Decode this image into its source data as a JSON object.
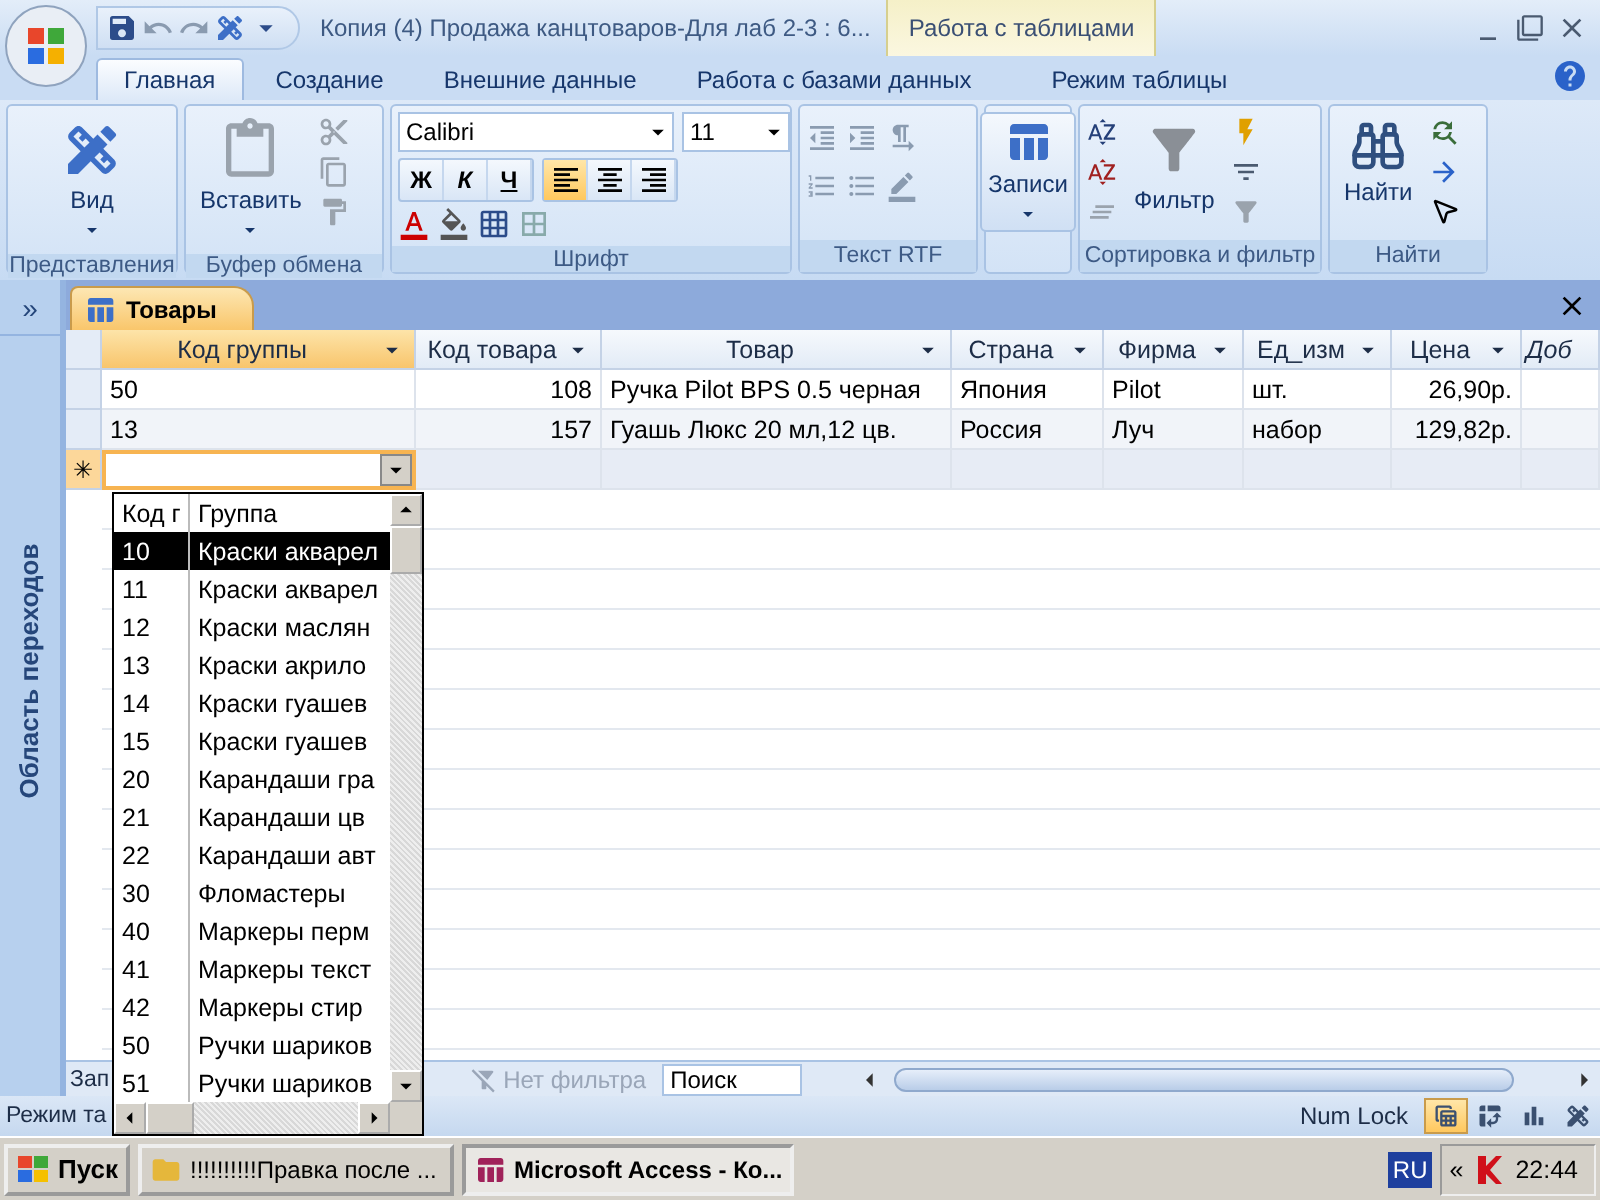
{
  "title_bar": {
    "title": "Копия (4) Продажа канцтоваров-Для лаб 2-3 : 6...",
    "context_tab": "Работа с таблицами"
  },
  "ribbon_tabs": [
    {
      "label": "Главная",
      "selected": true
    },
    {
      "label": "Создание",
      "selected": false
    },
    {
      "label": "Внешние данные",
      "selected": false
    },
    {
      "label": "Работа с базами данных",
      "selected": false
    },
    {
      "label": "Режим таблицы",
      "selected": false
    }
  ],
  "ribbon": {
    "views": {
      "label": "Представления",
      "button": "Вид"
    },
    "clipboard": {
      "label": "Буфер обмена",
      "button": "Вставить"
    },
    "font": {
      "label": "Шрифт",
      "font_name": "Calibri",
      "font_size": "11",
      "styles": [
        "Ж",
        "К",
        "Ч"
      ],
      "alignments": [
        {
          "selected": true
        },
        {
          "selected": false
        },
        {
          "selected": false
        }
      ]
    },
    "rich_text": {
      "label": "Текст RTF"
    },
    "records": {
      "button": "Записи"
    },
    "sort_filter": {
      "label": "Сортировка и фильтр",
      "button": "Фильтр"
    },
    "find": {
      "label": "Найти",
      "button": "Найти"
    }
  },
  "nav_pane": {
    "toggle": "»",
    "title": "Область переходов"
  },
  "document": {
    "tab": "Товары"
  },
  "table": {
    "columns": [
      {
        "label": "Код группы",
        "kind": "lookup",
        "selected": true
      },
      {
        "label": "Код товара",
        "kind": "number",
        "selected": false
      },
      {
        "label": "Товар",
        "kind": "text",
        "selected": false
      },
      {
        "label": "Страна",
        "kind": "text",
        "selected": false
      },
      {
        "label": "Фирма",
        "kind": "text",
        "selected": false
      },
      {
        "label": "Ед_изм",
        "kind": "text",
        "selected": false
      },
      {
        "label": "Цена",
        "kind": "number",
        "selected": false
      },
      {
        "label": "Доб",
        "kind": "new",
        "selected": false
      }
    ],
    "rows": [
      {
        "cells": [
          "50",
          "108",
          "Ручка Pilot BPS 0.5 черная",
          "Япония",
          "Pilot",
          "шт.",
          "26,90р."
        ]
      },
      {
        "cells": [
          "13",
          "157",
          "Гуашь Люкс 20 мл,12 цв.",
          "Россия",
          "Луч",
          "набор",
          "129,82р."
        ]
      }
    ],
    "new_row_marker": "✳"
  },
  "lookup_list": {
    "columns": [
      "Код г",
      "Группа"
    ],
    "items": [
      {
        "code": "10",
        "name": "Краски акварел",
        "selected": true
      },
      {
        "code": "11",
        "name": "Краски акварел",
        "selected": false
      },
      {
        "code": "12",
        "name": "Краски маслян",
        "selected": false
      },
      {
        "code": "13",
        "name": "Краски акрило",
        "selected": false
      },
      {
        "code": "14",
        "name": "Краски гуашев",
        "selected": false
      },
      {
        "code": "15",
        "name": "Краски гуашев",
        "selected": false
      },
      {
        "code": "20",
        "name": "Карандаши гра",
        "selected": false
      },
      {
        "code": "21",
        "name": "Карандаши цв",
        "selected": false
      },
      {
        "code": "22",
        "name": "Карандаши авт",
        "selected": false
      },
      {
        "code": "30",
        "name": "Фломастеры",
        "selected": false
      },
      {
        "code": "40",
        "name": "Маркеры перм",
        "selected": false
      },
      {
        "code": "41",
        "name": "Маркеры текст",
        "selected": false
      },
      {
        "code": "42",
        "name": "Маркеры стир",
        "selected": false
      },
      {
        "code": "50",
        "name": "Ручки шариков",
        "selected": false
      },
      {
        "code": "51",
        "name": "Ручки шариков",
        "selected": false
      }
    ]
  },
  "record_nav": {
    "label": "Зап",
    "filter": "Нет фильтра",
    "search_placeholder": "Поиск"
  },
  "status_bar": {
    "mode": "Режим та",
    "num_lock": "Num Lock",
    "views": [
      {
        "selected": true
      },
      {
        "selected": false
      },
      {
        "selected": false
      },
      {
        "selected": false
      }
    ]
  },
  "taskbar": {
    "start": "Пуск",
    "tasks": [
      {
        "label": "!!!!!!!!!!Правка после ...",
        "selected": false
      },
      {
        "label": "Microsoft Access - Ко...",
        "selected": true
      }
    ],
    "language": "RU",
    "tray_toggle": "«",
    "clock": "22:44"
  }
}
